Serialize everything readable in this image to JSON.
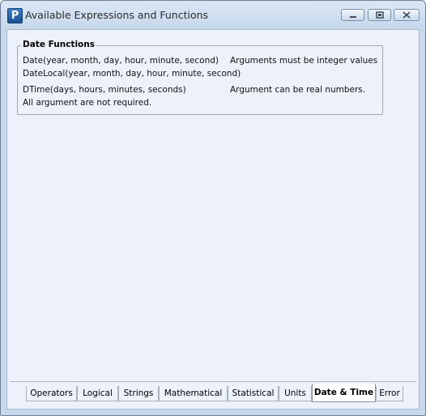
{
  "window": {
    "title": "Available Expressions and Functions",
    "app_icon_letter": "P"
  },
  "group": {
    "title": "Date Functions",
    "lines": [
      "Date(year, month, day, hour, minute, second)",
      "Arguments must be integer values",
      "DateLocal(year, month, day, hour, minute, second)",
      "DTime(days, hours, minutes, seconds)",
      "Argument can be real numbers.",
      "All argument are not required."
    ]
  },
  "tabs": [
    {
      "label": "Operators"
    },
    {
      "label": "Logical"
    },
    {
      "label": "Strings"
    },
    {
      "label": "Mathematical"
    },
    {
      "label": "Statistical"
    },
    {
      "label": "Units"
    },
    {
      "label": "Date & Time"
    },
    {
      "label": "Error"
    }
  ],
  "active_tab": "Date & Time"
}
